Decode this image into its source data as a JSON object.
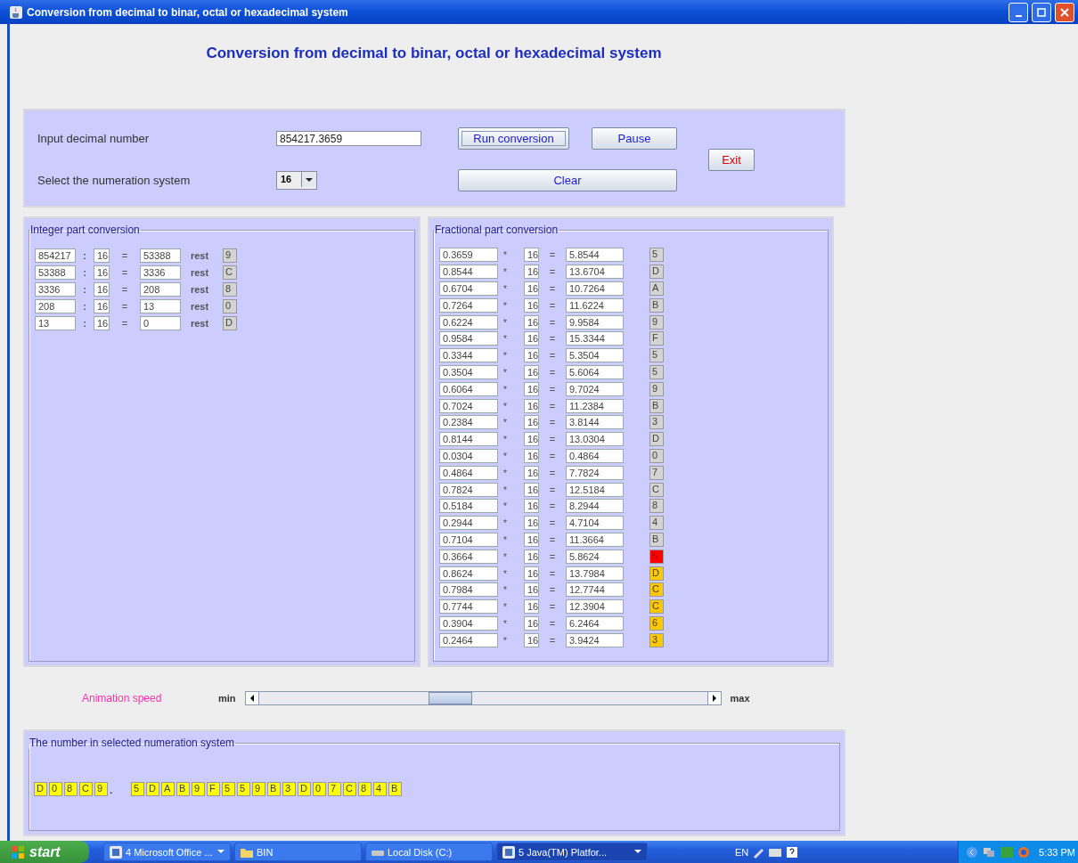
{
  "window": {
    "title": "Conversion from decimal to binar, octal or hexadecimal system"
  },
  "heading": "Conversion from decimal to binar, octal or hexadecimal system",
  "input_panel": {
    "number_label": "Input decimal number",
    "number_value": "854217.3659",
    "system_label": "Select the numeration system",
    "system_value": "16",
    "run_button": {
      "label": "Run conversion",
      "focused": true
    },
    "pause_button": {
      "label": "Pause",
      "focused": false
    },
    "clear_button": {
      "label": "Clear",
      "focused": false
    },
    "exit_button": {
      "label": "Exit",
      "focused": false
    }
  },
  "integer_panel": {
    "title": "Integer part conversion",
    "rows": [
      {
        "dividend": "854217",
        "operator": ":",
        "divisor": "16",
        "equals": "=",
        "quotient": "53388",
        "word": "rest",
        "remainder": "9"
      },
      {
        "dividend": "53388",
        "operator": ":",
        "divisor": "16",
        "equals": "=",
        "quotient": "3336",
        "word": "rest",
        "remainder": "C"
      },
      {
        "dividend": "3336",
        "operator": ":",
        "divisor": "16",
        "equals": "=",
        "quotient": "208",
        "word": "rest",
        "remainder": "8"
      },
      {
        "dividend": "208",
        "operator": ":",
        "divisor": "16",
        "equals": "=",
        "quotient": "13",
        "word": "rest",
        "remainder": "0"
      },
      {
        "dividend": "13",
        "operator": ":",
        "divisor": "16",
        "equals": "=",
        "quotient": "0",
        "word": "rest",
        "remainder": "D"
      }
    ]
  },
  "fraction_panel": {
    "title": "Fractional part conversion",
    "rows": [
      {
        "value": "0.3659",
        "operator": "*",
        "multiplier": "16",
        "equals": "=",
        "product": "5.8544",
        "digit": "5",
        "color": "#d4d4d4"
      },
      {
        "value": "0.8544",
        "operator": "*",
        "multiplier": "16",
        "equals": "=",
        "product": "13.6704",
        "digit": "D",
        "color": "#d4d4d4"
      },
      {
        "value": "0.6704",
        "operator": "*",
        "multiplier": "16",
        "equals": "=",
        "product": "10.7264",
        "digit": "A",
        "color": "#d4d4d4"
      },
      {
        "value": "0.7264",
        "operator": "*",
        "multiplier": "16",
        "equals": "=",
        "product": "11.6224",
        "digit": "B",
        "color": "#d4d4d4"
      },
      {
        "value": "0.6224",
        "operator": "*",
        "multiplier": "16",
        "equals": "=",
        "product": "9.9584",
        "digit": "9",
        "color": "#d4d4d4"
      },
      {
        "value": "0.9584",
        "operator": "*",
        "multiplier": "16",
        "equals": "=",
        "product": "15.3344",
        "digit": "F",
        "color": "#d4d4d4"
      },
      {
        "value": "0.3344",
        "operator": "*",
        "multiplier": "16",
        "equals": "=",
        "product": "5.3504",
        "digit": "5",
        "color": "#d4d4d4"
      },
      {
        "value": "0.3504",
        "operator": "*",
        "multiplier": "16",
        "equals": "=",
        "product": "5.6064",
        "digit": "5",
        "color": "#d4d4d4"
      },
      {
        "value": "0.6064",
        "operator": "*",
        "multiplier": "16",
        "equals": "=",
        "product": "9.7024",
        "digit": "9",
        "color": "#d4d4d4"
      },
      {
        "value": "0.7024",
        "operator": "*",
        "multiplier": "16",
        "equals": "=",
        "product": "11.2384",
        "digit": "B",
        "color": "#d4d4d4"
      },
      {
        "value": "0.2384",
        "operator": "*",
        "multiplier": "16",
        "equals": "=",
        "product": "3.8144",
        "digit": "3",
        "color": "#d4d4d4"
      },
      {
        "value": "0.8144",
        "operator": "*",
        "multiplier": "16",
        "equals": "=",
        "product": "13.0304",
        "digit": "D",
        "color": "#d4d4d4"
      },
      {
        "value": "0.0304",
        "operator": "*",
        "multiplier": "16",
        "equals": "=",
        "product": "0.4864",
        "digit": "0",
        "color": "#d4d4d4"
      },
      {
        "value": "0.4864",
        "operator": "*",
        "multiplier": "16",
        "equals": "=",
        "product": "7.7824",
        "digit": "7",
        "color": "#d4d4d4"
      },
      {
        "value": "0.7824",
        "operator": "*",
        "multiplier": "16",
        "equals": "=",
        "product": "12.5184",
        "digit": "C",
        "color": "#d4d4d4"
      },
      {
        "value": "0.5184",
        "operator": "*",
        "multiplier": "16",
        "equals": "=",
        "product": "8.2944",
        "digit": "8",
        "color": "#d4d4d4"
      },
      {
        "value": "0.2944",
        "operator": "*",
        "multiplier": "16",
        "equals": "=",
        "product": "4.7104",
        "digit": "4",
        "color": "#d4d4d4"
      },
      {
        "value": "0.7104",
        "operator": "*",
        "multiplier": "16",
        "equals": "=",
        "product": "11.3664",
        "digit": "B",
        "color": "#d4d4d4"
      },
      {
        "value": "0.3664",
        "operator": "*",
        "multiplier": "16",
        "equals": "=",
        "product": "5.8624",
        "digit": "5",
        "color": "#ff0000"
      },
      {
        "value": "0.8624",
        "operator": "*",
        "multiplier": "16",
        "equals": "=",
        "product": "13.7984",
        "digit": "D",
        "color": "#ffc800"
      },
      {
        "value": "0.7984",
        "operator": "*",
        "multiplier": "16",
        "equals": "=",
        "product": "12.7744",
        "digit": "C",
        "color": "#ffc800"
      },
      {
        "value": "0.7744",
        "operator": "*",
        "multiplier": "16",
        "equals": "=",
        "product": "12.3904",
        "digit": "C",
        "color": "#ffc800"
      },
      {
        "value": "0.3904",
        "operator": "*",
        "multiplier": "16",
        "equals": "=",
        "product": "6.2464",
        "digit": "6",
        "color": "#ffc800"
      },
      {
        "value": "0.2464",
        "operator": "*",
        "multiplier": "16",
        "equals": "=",
        "product": "3.9424",
        "digit": "3",
        "color": "#ffc800"
      }
    ]
  },
  "speed": {
    "label": "Animation speed",
    "min_label": "min",
    "max_label": "max",
    "level": 0.42
  },
  "result_panel": {
    "title": "The number in selected numeration system",
    "integer_digits": [
      "D",
      "0",
      "8",
      "C",
      "9"
    ],
    "separator": ".",
    "fraction_digits": [
      "5",
      "D",
      "A",
      "B",
      "9",
      "F",
      "5",
      "5",
      "9",
      "B",
      "3",
      "D",
      "0",
      "7",
      "C",
      "8",
      "4",
      "B"
    ]
  },
  "taskbar": {
    "start": "start",
    "items": [
      {
        "label": "4 Microsoft Office ...",
        "kind": "group",
        "selected": false
      },
      {
        "label": "BIN",
        "kind": "folder",
        "selected": false
      },
      {
        "label": "Local Disk (C:)",
        "kind": "drive",
        "selected": false
      },
      {
        "label": "5 Java(TM) Platfor...",
        "kind": "group",
        "selected": true
      }
    ],
    "language": "EN",
    "clock": "5:33 PM"
  }
}
